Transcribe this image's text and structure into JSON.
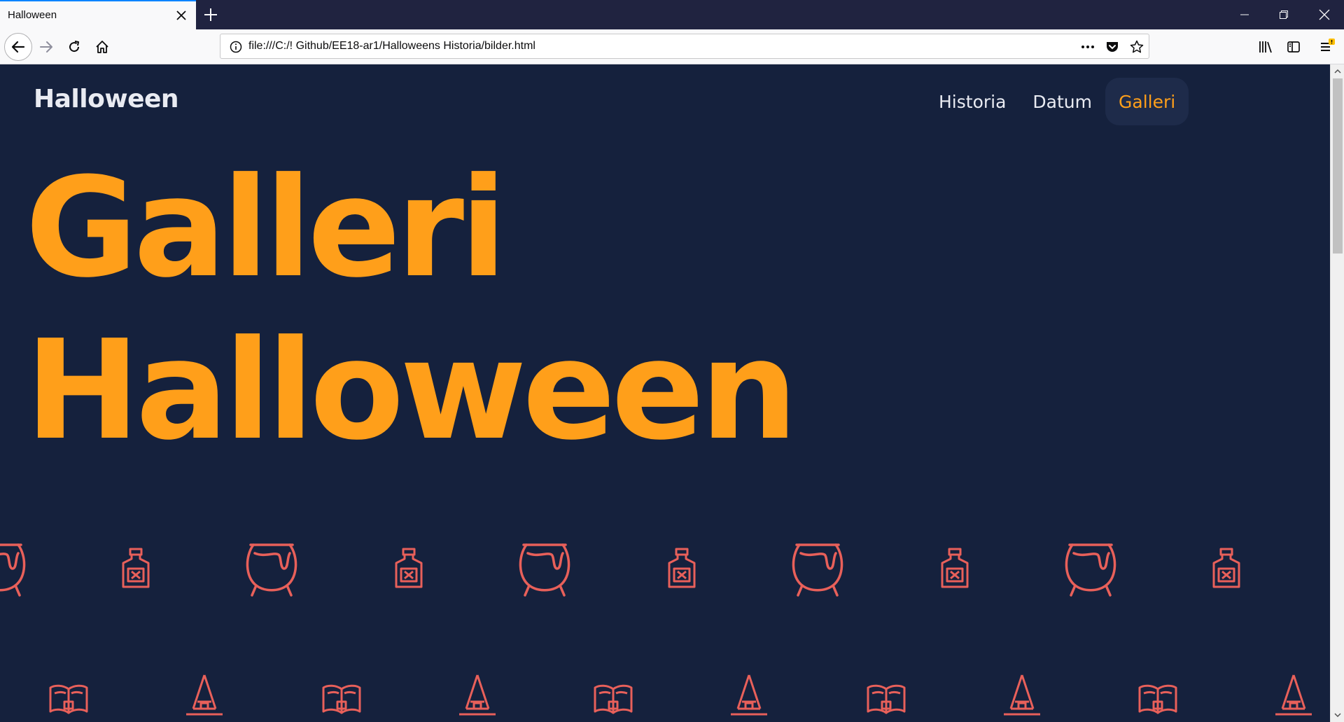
{
  "browser": {
    "tab_title": "Halloween",
    "url": "file:///C:/! Github/EE18-ar1/Halloweens Historia/bilder.html",
    "accent_color": "#0a84ff"
  },
  "site": {
    "brand": "Halloween",
    "nav": [
      {
        "label": "Historia",
        "active": false
      },
      {
        "label": "Datum",
        "active": false
      },
      {
        "label": "Galleri",
        "active": true
      }
    ],
    "hero_line1": "Galleri",
    "hero_line2": "Halloween",
    "colors": {
      "background": "#15213d",
      "accent": "#ff9f1a",
      "icon": "#e8605a",
      "text": "#e9ebf2"
    },
    "pattern_row1_icons": [
      "cauldron-icon",
      "potion-bottle-icon"
    ],
    "pattern_row2_icons": [
      "spell-book-icon",
      "witch-hat-icon"
    ]
  }
}
